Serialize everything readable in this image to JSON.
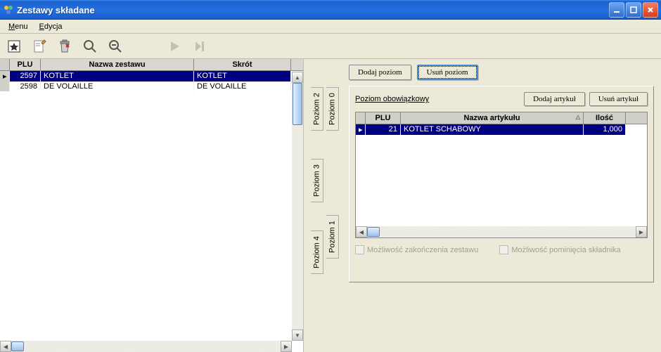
{
  "window": {
    "title": "Zestawy składane"
  },
  "menu": {
    "items": [
      "Menu",
      "Edycja"
    ]
  },
  "left_grid": {
    "headers": {
      "plu": "PLU",
      "name": "Nazwa zestawu",
      "short": "Skrót"
    },
    "rows": [
      {
        "plu": "2597",
        "name": "KOTLET",
        "short": "KOTLET",
        "selected": true
      },
      {
        "plu": "2598",
        "name": "DE VOLAILLE",
        "short": "DE VOLAILLE",
        "selected": false
      }
    ]
  },
  "right": {
    "add_level": "Dodaj poziom",
    "del_level": "Usuń poziom",
    "mandatory_level": "Poziom obowiązkowy",
    "add_article": "Dodaj artykuł",
    "del_article": "Usuń artykuł",
    "outer_tabs": [
      "Poziom 2",
      "Poziom 3",
      "Poziom 4"
    ],
    "inner_tabs": [
      "Poziom 0",
      "Poziom 1"
    ],
    "detail_headers": {
      "plu": "PLU",
      "name": "Nazwa artykułu",
      "qty": "Ilość"
    },
    "detail_rows": [
      {
        "plu": "21",
        "name": "KOTLET SCHABOWY",
        "qty": "1,000"
      }
    ],
    "chk1": "Możliwość zakończenia zestawu",
    "chk2": "Możliwość pominięcia składnika"
  }
}
